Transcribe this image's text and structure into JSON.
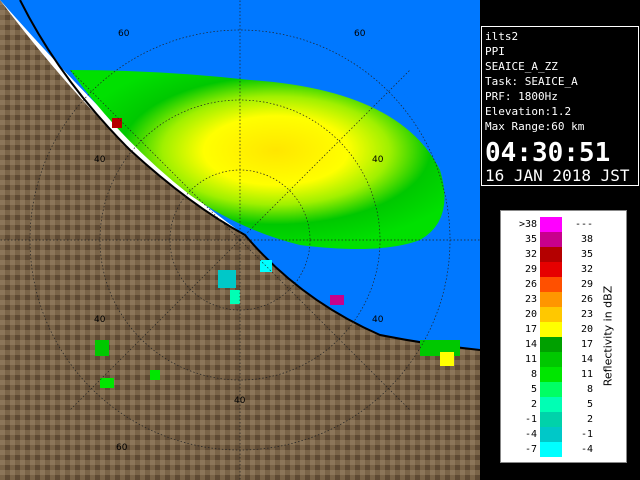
{
  "info": {
    "station": "ilts2",
    "product": "PPI",
    "product_name": "SEAICE_A_ZZ",
    "task": "Task: SEAICE_A",
    "prf": "PRF: 1800Hz",
    "elevation": "Elevation:1.2",
    "max_range": "Max Range:60 km",
    "time": "04:30:51",
    "date": "16 JAN 2018 JST"
  },
  "legend": {
    "unit_label": "Reflectivity in dBZ",
    "rows": [
      {
        "left": ">38",
        "right": "---",
        "color": "#ff00ff"
      },
      {
        "left": "35",
        "right": "38",
        "color": "#c8008c"
      },
      {
        "left": "32",
        "right": "35",
        "color": "#b40000"
      },
      {
        "left": "29",
        "right": "32",
        "color": "#e60000"
      },
      {
        "left": "26",
        "right": "29",
        "color": "#ff5000"
      },
      {
        "left": "23",
        "right": "26",
        "color": "#ff9600"
      },
      {
        "left": "20",
        "right": "23",
        "color": "#ffc800"
      },
      {
        "left": "17",
        "right": "20",
        "color": "#ffff00"
      },
      {
        "left": "14",
        "right": "17",
        "color": "#00a000"
      },
      {
        "left": "11",
        "right": "14",
        "color": "#00c800"
      },
      {
        "left": "8",
        "right": "11",
        "color": "#00e600"
      },
      {
        "left": "5",
        "right": "8",
        "color": "#00ff64"
      },
      {
        "left": "2",
        "right": "5",
        "color": "#00ffb4"
      },
      {
        "left": "-1",
        "right": "2",
        "color": "#00d2aa"
      },
      {
        "left": "-4",
        "right": "-1",
        "color": "#00c8c8"
      },
      {
        "left": "-7",
        "right": "-4",
        "color": "#00ffff"
      }
    ]
  },
  "radar": {
    "ring_labels": [
      "60",
      "60",
      "40",
      "40",
      "40",
      "40",
      "40",
      "60"
    ]
  },
  "colors": {
    "sea_blue": "#0078ff",
    "land": "#7a6448",
    "coast": "#000000"
  }
}
